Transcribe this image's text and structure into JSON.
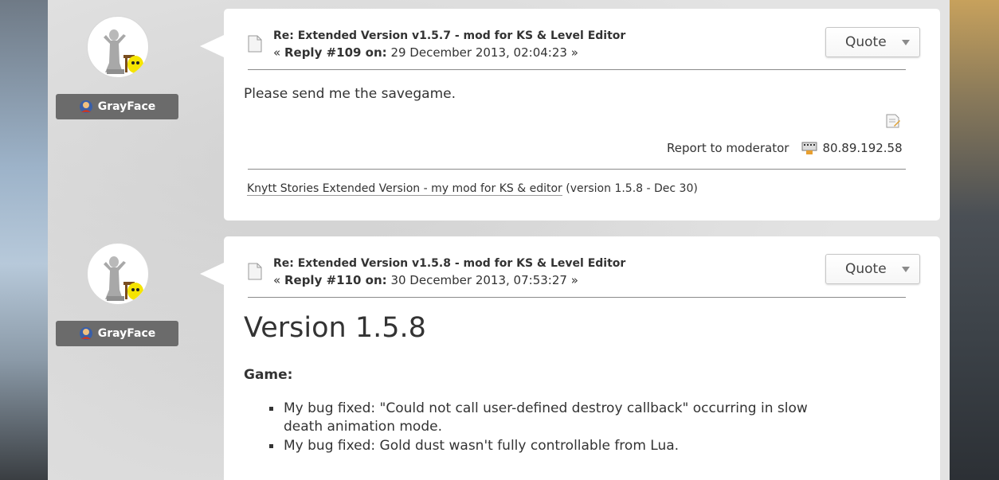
{
  "posts": [
    {
      "author": "GrayFace",
      "subject": "Re: Extended Version v1.5.7 - mod for KS & Level Editor",
      "meta_prefix": "«",
      "reply_label": "Reply #109 on:",
      "date": "29 December 2013, 02:04:23",
      "meta_suffix": "»",
      "quote_label": "Quote",
      "body": "Please send me the savegame.",
      "report_label": "Report to moderator",
      "ip": "80.89.192.58",
      "signature_link": "Knytt Stories Extended Version - my mod for KS & editor",
      "signature_note": "(version 1.5.8 - Dec 30)"
    },
    {
      "author": "GrayFace",
      "subject": "Re: Extended Version v1.5.8 - mod for KS & Level Editor",
      "meta_prefix": "«",
      "reply_label": "Reply #110 on:",
      "date": "30 December 2013, 07:53:27",
      "meta_suffix": "»",
      "quote_label": "Quote",
      "heading": "Version 1.5.8",
      "section_label": "Game:",
      "bullets": [
        "My bug fixed: \"Could not call user-defined destroy callback\" occurring in slow death animation mode.",
        "My bug fixed: Gold dust wasn't fully controllable from Lua."
      ]
    }
  ],
  "icons": {
    "post": "document-icon",
    "quote_dropdown": "chevron-down-icon",
    "edit": "edit-icon",
    "ip": "ip-address-icon",
    "author_badge": "user-badge-icon"
  }
}
